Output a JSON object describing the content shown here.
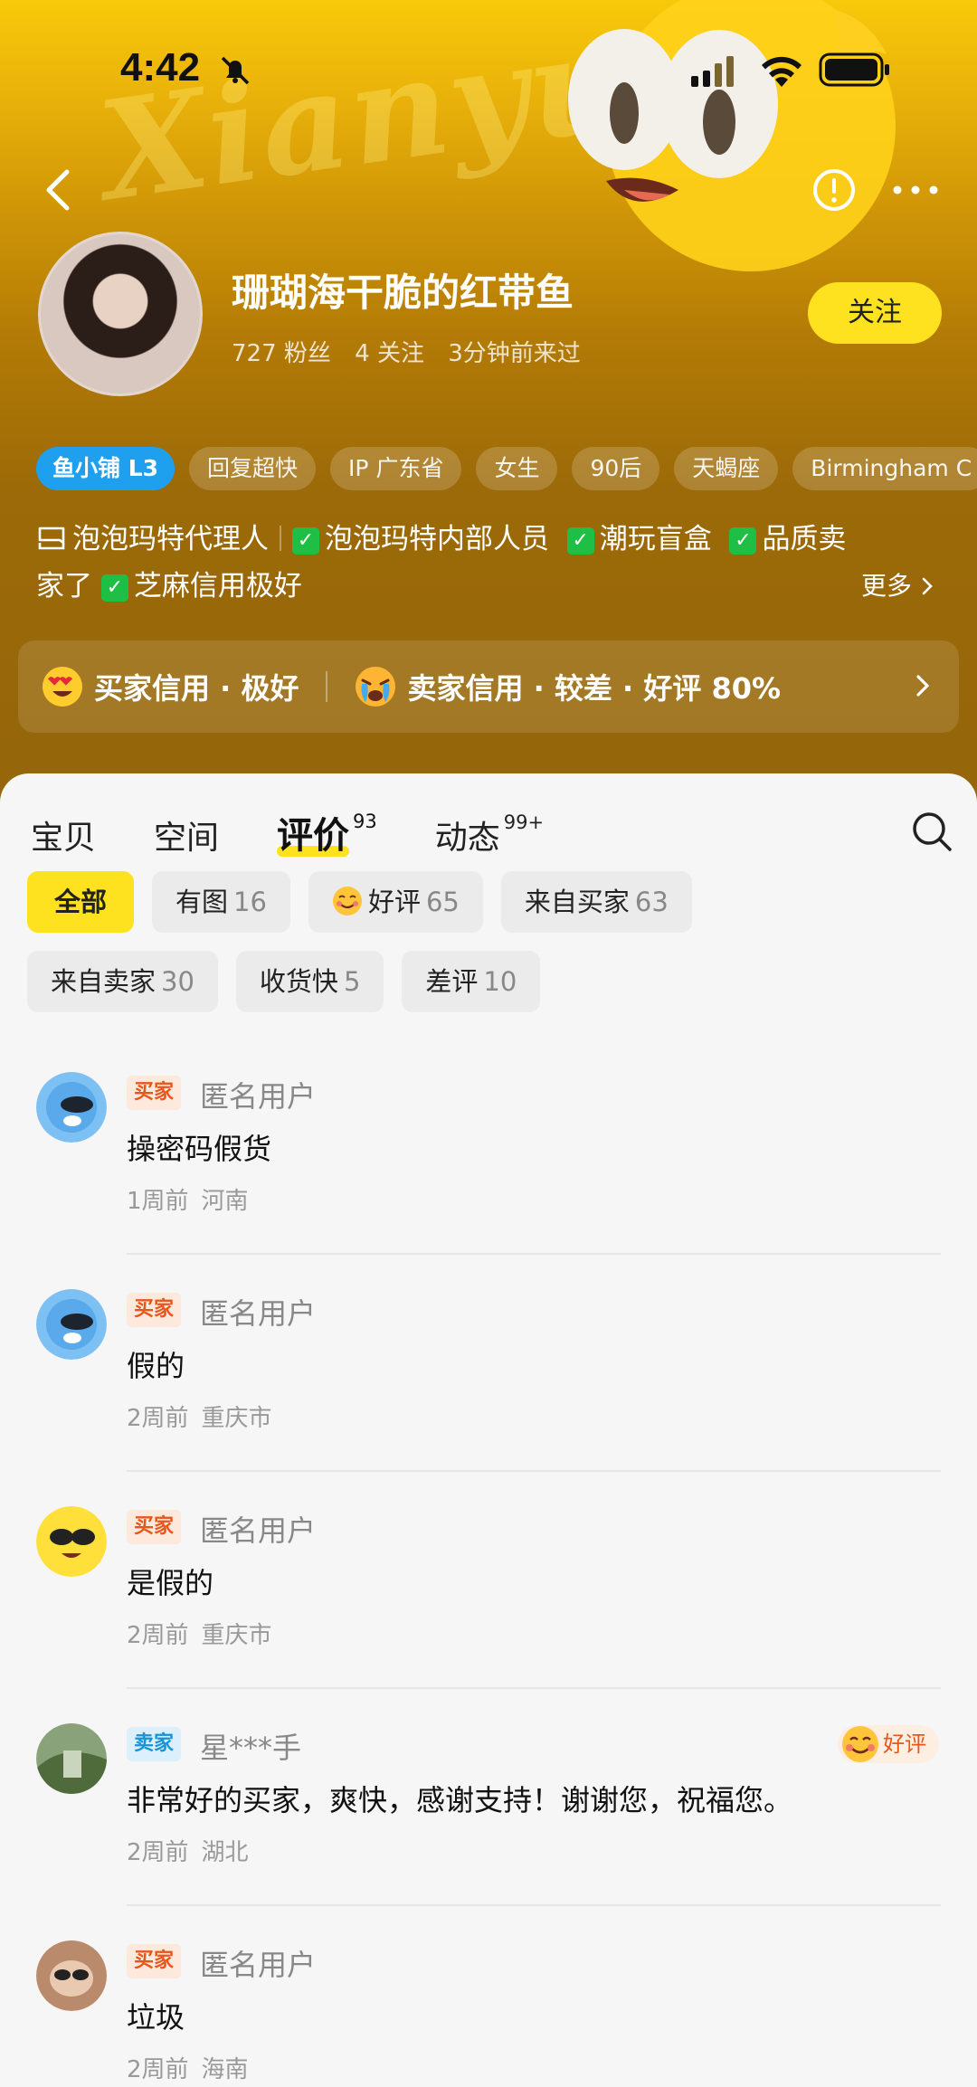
{
  "status_bar": {
    "time": "4:42"
  },
  "header": {
    "watermark": "Xianyu",
    "username": "珊瑚海干脆的红带鱼",
    "stats": {
      "fans": "727 粉丝",
      "following": "4 关注",
      "last_seen": "3分钟前来过"
    },
    "follow_label": "关注",
    "tags": [
      "鱼小铺 L3",
      "回复超快",
      "IP 广东省",
      "女生",
      "90后",
      "天蝎座",
      "Birmingham C"
    ],
    "badges": {
      "agent": "泡泡玛特代理人",
      "insider": "泡泡玛特内部人员",
      "blind_box": "潮玩盲盒",
      "quality_seller_1": "品质卖",
      "quality_seller_2": "家了",
      "sesame": "芝麻信用极好"
    },
    "more_label": "更多",
    "credit": {
      "buyer": "买家信用 · 极好",
      "seller": "卖家信用 · 较差 · 好评 80%"
    }
  },
  "tabs": [
    {
      "label": "宝贝",
      "count": ""
    },
    {
      "label": "空间",
      "count": ""
    },
    {
      "label": "评价",
      "count": "93"
    },
    {
      "label": "动态",
      "count": "99+"
    }
  ],
  "filters": [
    {
      "label": "全部",
      "count": ""
    },
    {
      "label": "有图",
      "count": "16"
    },
    {
      "label": "好评",
      "count": "65"
    },
    {
      "label": "来自买家",
      "count": "63"
    },
    {
      "label": "来自卖家",
      "count": "30"
    },
    {
      "label": "收货快",
      "count": "5"
    },
    {
      "label": "差评",
      "count": "10"
    }
  ],
  "reviews": [
    {
      "role": "买家",
      "name": "匿名用户",
      "text": "操密码假货",
      "time": "1周前",
      "location": "河南"
    },
    {
      "role": "买家",
      "name": "匿名用户",
      "text": "假的",
      "time": "2周前",
      "location": "重庆市"
    },
    {
      "role": "买家",
      "name": "匿名用户",
      "text": "是假的",
      "time": "2周前",
      "location": "重庆市"
    },
    {
      "role": "卖家",
      "name": "星***手",
      "text": "非常好的买家，爽快，感谢支持！谢谢您，祝福您。",
      "time": "2周前",
      "location": "湖北",
      "rating": "好评"
    },
    {
      "role": "买家",
      "name": "匿名用户",
      "text": "垃圾",
      "time": "2周前",
      "location": "海南"
    }
  ]
}
